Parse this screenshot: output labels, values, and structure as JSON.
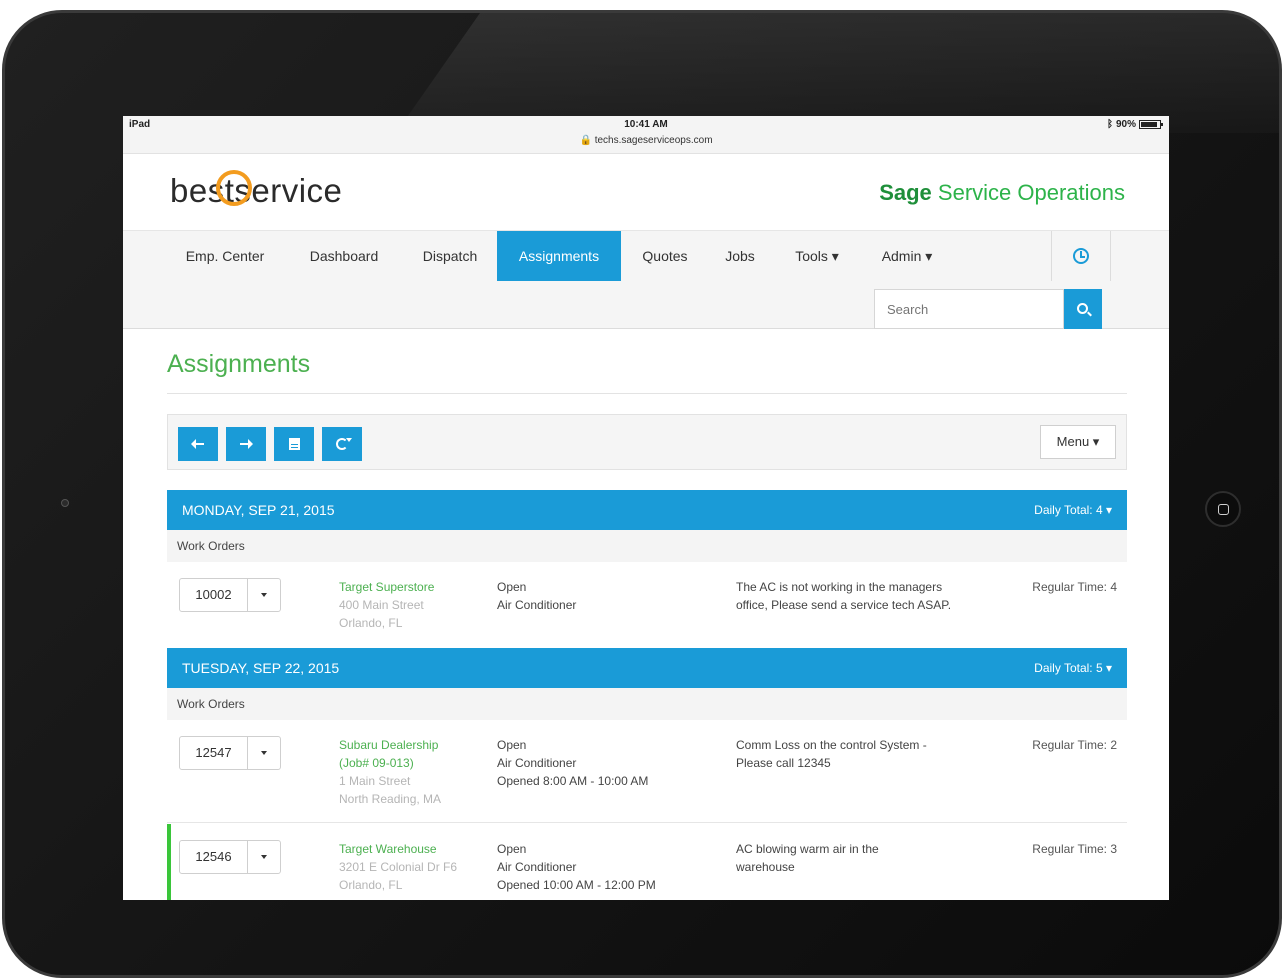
{
  "status_bar": {
    "carrier": "iPad",
    "time": "10:41 AM",
    "url": "techs.sageserviceops.com",
    "battery": "90%"
  },
  "brand": {
    "logo_left": "best",
    "logo_right": "service",
    "product_bold": "Sage",
    "product_rest": "Service Operations"
  },
  "nav": {
    "items": [
      "Emp. Center",
      "Dashboard",
      "Dispatch",
      "Assignments",
      "Quotes",
      "Jobs",
      "Tools ▾",
      "Admin ▾"
    ],
    "active": "Assignments",
    "search_placeholder": "Search"
  },
  "page": {
    "title": "Assignments",
    "menu_label": "Menu ▾"
  },
  "toolbar": {
    "buttons": [
      "arrow-left-icon",
      "arrow-right-icon",
      "calendar-icon",
      "refresh-icon"
    ]
  },
  "days": [
    {
      "date": "MONDAY, SEP 21, 2015",
      "total": "Daily Total: 4 ▾",
      "section": "Work Orders",
      "rows": [
        {
          "order": "10002",
          "customer": "Target Superstore",
          "addr1": "400 Main Street",
          "addr2": "Orlando, FL",
          "status1": "Open",
          "status2": "Air Conditioner",
          "status3": "",
          "desc": "The AC is not working in the managers office, Please send a service tech ASAP.",
          "time": "Regular Time: 4"
        }
      ]
    },
    {
      "date": "TUESDAY, SEP 22, 2015",
      "total": "Daily Total: 5 ▾",
      "section": "Work Orders",
      "rows": [
        {
          "order": "12547",
          "customer": "Subaru Dealership",
          "customer2": "(Job# 09-013)",
          "addr1": "1 Main Street",
          "addr2": "North Reading, MA",
          "status1": "Open",
          "status2": "Air Conditioner",
          "status3": "Opened 8:00 AM - 10:00 AM",
          "desc": "Comm Loss on the control System - Please call 12345",
          "time": "Regular Time: 2"
        },
        {
          "order": "12546",
          "customer": "Target Warehouse",
          "addr1": "3201 E Colonial Dr F6",
          "addr2": "Orlando, FL",
          "status1": "Open",
          "status2": "Air Conditioner",
          "status3": "Opened 10:00 AM - 12:00 PM",
          "desc": "AC blowing warm air in the warehouse",
          "time": "Regular Time: 3"
        }
      ]
    }
  ],
  "colors": {
    "accent_blue": "#1a9bd7",
    "title_green": "#4cb050",
    "logo_orange": "#f39c1f",
    "highlight_green": "#3ac53a"
  }
}
